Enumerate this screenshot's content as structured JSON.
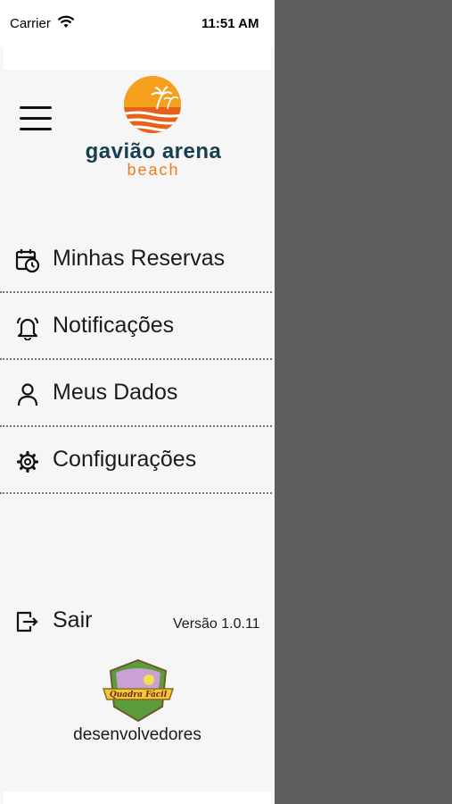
{
  "status_bar": {
    "carrier": "Carrier",
    "time": "11:51 AM"
  },
  "brand": {
    "name": "gavião arena",
    "subtitle": "beach",
    "colors": {
      "dark": "#16404f",
      "orange": "#ee7d1e"
    }
  },
  "menu": {
    "items": [
      {
        "label": "Minhas Reservas",
        "icon": "calendar-clock-icon"
      },
      {
        "label": "Notificações",
        "icon": "bell-icon"
      },
      {
        "label": "Meus Dados",
        "icon": "user-icon"
      },
      {
        "label": "Configurações",
        "icon": "gear-icon"
      }
    ]
  },
  "footer": {
    "logout_label": "Sair",
    "version": "Versão 1.0.11",
    "developer_logo_text": "Quadra Fácil",
    "developer_label": "desenvolvedores"
  }
}
